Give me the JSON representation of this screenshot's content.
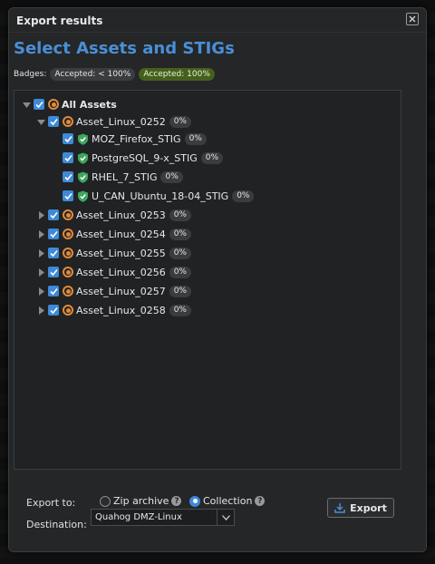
{
  "dialog": {
    "title": "Export results"
  },
  "heading": "Select Assets and STIGs",
  "badges": {
    "label": "Badges:",
    "partial": "Accepted: < 100%",
    "full": "Accepted: 100%"
  },
  "tree": {
    "root": {
      "label": "All Assets"
    },
    "expanded_asset": {
      "label": "Asset_Linux_0252",
      "pct": "0%",
      "stigs": [
        {
          "label": "MOZ_Firefox_STIG",
          "pct": "0%"
        },
        {
          "label": "PostgreSQL_9-x_STIG",
          "pct": "0%"
        },
        {
          "label": "RHEL_7_STIG",
          "pct": "0%"
        },
        {
          "label": "U_CAN_Ubuntu_18-04_STIG",
          "pct": "0%"
        }
      ]
    },
    "collapsed_assets": [
      {
        "label": "Asset_Linux_0253",
        "pct": "0%"
      },
      {
        "label": "Asset_Linux_0254",
        "pct": "0%"
      },
      {
        "label": "Asset_Linux_0255",
        "pct": "0%"
      },
      {
        "label": "Asset_Linux_0256",
        "pct": "0%"
      },
      {
        "label": "Asset_Linux_0257",
        "pct": "0%"
      },
      {
        "label": "Asset_Linux_0258",
        "pct": "0%"
      }
    ]
  },
  "footer": {
    "export_to_label": "Export to:",
    "zip_label": "Zip archive",
    "collection_label": "Collection",
    "destination_label": "Destination:",
    "destination_value": "Quahog DMZ-Linux",
    "export_button": "Export"
  },
  "colors": {
    "accent": "#3d8ad8",
    "heading": "#4a8fd6",
    "asset_icon": "#e08a3c",
    "stig_icon": "#3fa55c",
    "badge_full": "#45601d"
  }
}
